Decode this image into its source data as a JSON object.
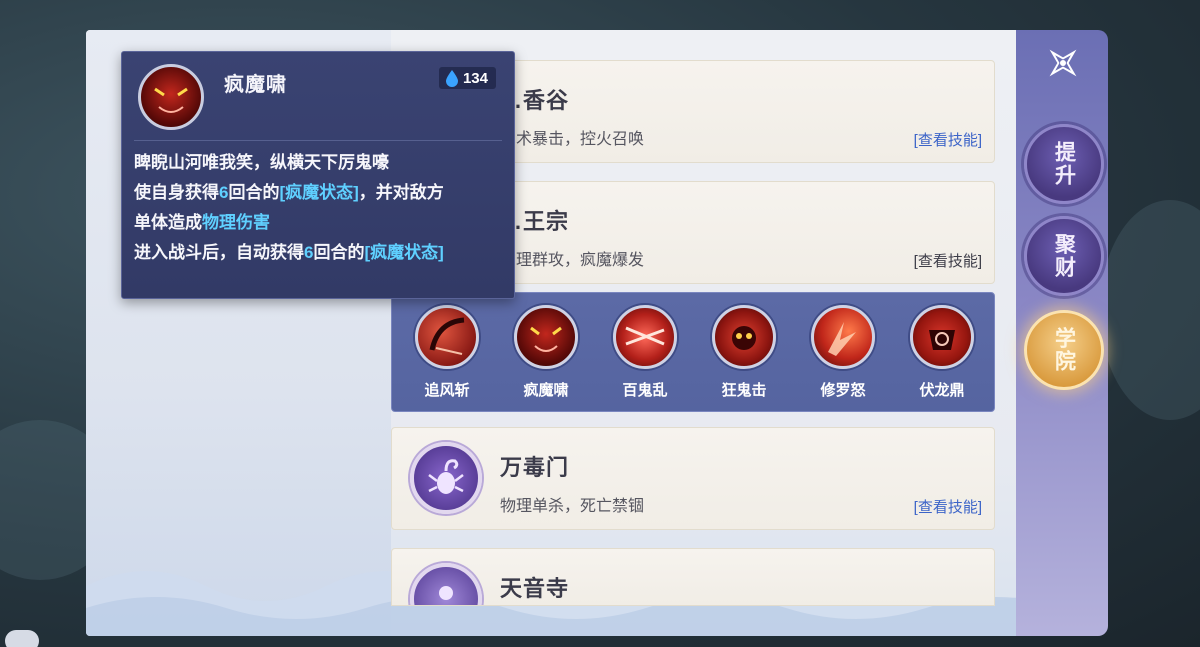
{
  "schools": [
    {
      "title": "…香谷",
      "desc": "…术暴击，控火召唤",
      "link": "[查看技能]",
      "emblem_icon": "flame-emblem-icon"
    },
    {
      "title": "…王宗",
      "desc": "…理群攻，疯魔爆发",
      "link": "[查看技能]",
      "emblem_icon": "demon-emblem-icon"
    },
    {
      "title": "万毒门",
      "desc": "物理单杀，死亡禁锢",
      "link": "[查看技能]",
      "emblem_icon": "scorpion-icon"
    },
    {
      "title": "天音寺",
      "emblem_icon": "buddha-icon"
    }
  ],
  "skills": [
    {
      "name": "追风斩",
      "icon": "slash-skill-icon"
    },
    {
      "name": "疯魔啸",
      "icon": "demon-face-skill-icon"
    },
    {
      "name": "百鬼乱",
      "icon": "cross-slash-skill-icon"
    },
    {
      "name": "狂鬼击",
      "icon": "ghost-strike-skill-icon"
    },
    {
      "name": "修罗怒",
      "icon": "fury-skill-icon"
    },
    {
      "name": "伏龙鼎",
      "icon": "cauldron-skill-icon"
    }
  ],
  "tooltip": {
    "skill_name": "疯魔啸",
    "cost": "134",
    "line1": "睥睨山河唯我笑，纵横天下厉鬼嚎",
    "line2_a": "使自身获得",
    "line2_num": "6",
    "line2_b": "回合的",
    "line2_state": "[疯魔状态]",
    "line2_c": "，并对敌方",
    "line3_a": "单体造成",
    "line3_dmg": "物理伤害",
    "line4_a": "进入战斗后，自动获得",
    "line4_num": "6",
    "line4_b": "回合的",
    "line4_state": "[疯魔状态]"
  },
  "rail": {
    "upgrade": "提升",
    "wealth": "聚财",
    "academy": "学院"
  },
  "colors": {
    "highlight": "#5fd0ff",
    "link": "#3c64c8",
    "tooltip_bg": "#3a4372",
    "skill_strip": "#5c6aa6"
  }
}
